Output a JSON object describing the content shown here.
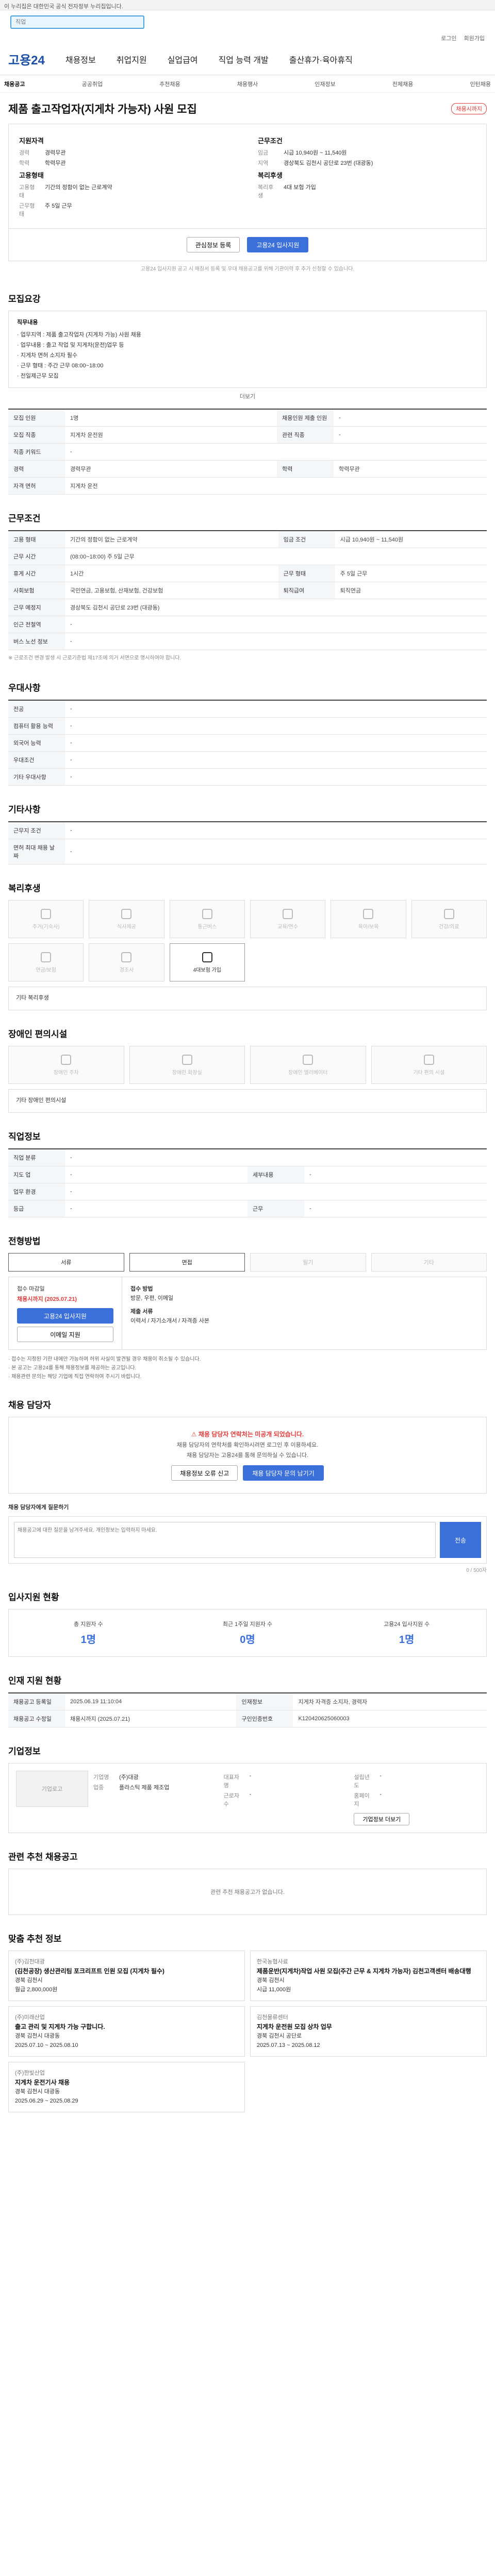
{
  "gov_bar": "이 누리집은 대한민국 공식 전자정부 누리집입니다.",
  "search": {
    "placeholder": "직업"
  },
  "util": [
    "로그인",
    "회원가입"
  ],
  "gnb": {
    "logo": "고용24",
    "items": [
      "채용정보",
      "취업지원",
      "실업급여",
      "직업 능력 개발",
      "출산휴가·육아휴직"
    ]
  },
  "subnav": [
    "채용공고",
    "공공취업",
    "추천채용",
    "채용행사",
    "인재정보",
    "전체채용",
    "인턴채용"
  ],
  "job": {
    "title": "제품 출고작업자(지게차 가능자) 사원 모집",
    "badge": "채용시까지"
  },
  "summary": {
    "left_h": "지원자격",
    "left": [
      [
        "경력",
        "경력무관"
      ],
      [
        "학력",
        "학력무관"
      ]
    ],
    "left2_h": "고용형태",
    "left2": [
      [
        "고용형태",
        "기간의 정함이 없는 근로계약"
      ],
      [
        "근무형태",
        "주 5일 근무"
      ]
    ],
    "right_h": "근무조건",
    "right": [
      [
        "임금",
        "시급 10,940원 ~ 11,540원"
      ],
      [
        "지역",
        "경상북도 김천시 공단로 23번 (대광동)"
      ]
    ],
    "right2_h": "복리후생",
    "right2": [
      [
        "복리후생",
        "4대 보험 가입"
      ]
    ]
  },
  "buttons": {
    "scrap": "관심정보 등록",
    "apply": "고용24 입사지원"
  },
  "apply_note": "고용24 입사지원 공고 시 매칭서 등록 및 우대 채용공고를 위해 기관이력 후 추가 신청할 수 있습니다.",
  "sec_job": "모집요강",
  "job_desc_title": "직무내용",
  "job_desc": [
    "· 업무지역 : 제품 출고작업자 (지게차 가능) 사원 채용",
    "· 업무내용 : 출고 작업 및 지게차(운전)업무 등",
    "· 지게차 면허 소지자 필수",
    "· 근무 형태 : 주간 근무 08:00~18:00",
    "· 전일제근무 모집"
  ],
  "expand": "더보기",
  "req_table": [
    [
      "모집 인원",
      "1명",
      "채용인원 제출 인원",
      "-"
    ],
    [
      "모집 직종",
      "지게차 운전원",
      "관련 직종",
      "-"
    ],
    [
      "직종 키워드",
      "-",
      "",
      ""
    ],
    [
      "경력",
      "경력무관",
      "학력",
      "학력무관"
    ],
    [
      "자격 면허",
      "지게차 운전",
      "",
      ""
    ]
  ],
  "sec_cond": "근무조건",
  "cond_table": [
    [
      "고용 형태",
      "기간의 정함이 없는 근로계약",
      "임금 조건",
      "시급 10,940원 ~ 11,540원"
    ],
    [
      "근무 시간",
      "(08:00~18:00) 주 5일 근무",
      "",
      ""
    ],
    [
      "휴게 시간",
      "1시간",
      "근무 형태",
      "주 5일 근무"
    ],
    [
      "사회보험",
      "국민연금, 고용보험, 산재보험, 건강보험",
      "퇴직급여",
      "퇴직연금"
    ],
    [
      "근무 예정지",
      "경상북도 김천시 공단로 23번 (대광동)",
      "",
      ""
    ],
    [
      "인근 전철역",
      "-",
      "",
      ""
    ],
    [
      "버스 노선 정보",
      "-",
      "",
      ""
    ]
  ],
  "cond_note": "※ 근로조건 변경 발생 시 근로기준법 제17조에 의거 서면으로 명시하여야 합니다.",
  "sec_pref": "우대사항",
  "pref_table": [
    [
      "전공",
      "-"
    ],
    [
      "컴퓨터 활용 능력",
      "-"
    ],
    [
      "외국어 능력",
      "-"
    ],
    [
      "우대조건",
      "-"
    ],
    [
      "기타 우대사항",
      "-"
    ]
  ],
  "sec_etc": "기타사항",
  "etc_table": [
    [
      "근무지 조건",
      "-"
    ],
    [
      "면허 최대 채용 날짜",
      "-"
    ]
  ],
  "sec_welfare": "복리후생",
  "welfare_icons": [
    "주거(기숙사)",
    "식사제공",
    "통근버스",
    "교육/연수",
    "육아/보육",
    "건강/의료",
    "연금/보험",
    "경조사",
    "4대보험 가입"
  ],
  "welfare_on": [
    8
  ],
  "etc_welfare": "기타 복리후생",
  "sec_disab": "장애인 편의시설",
  "disab_icons": [
    "장애인 주차",
    "장애인 화장실",
    "장애인 엘리베이터",
    "기타 편의 시설"
  ],
  "etc_disab": "기타 장애인 편의시설",
  "sec_jobinfo": "직업정보",
  "jobinfo_table": [
    [
      "직업 분류",
      "-",
      "",
      ""
    ],
    [
      "지도 업",
      "-",
      "세부내용",
      "-"
    ],
    [
      "업무 환경",
      "-",
      "",
      ""
    ],
    [
      "등급",
      "-",
      "근무",
      "-"
    ]
  ],
  "sec_method": "전형방법",
  "methods": [
    "서류",
    "면접",
    "필기",
    "기타"
  ],
  "methods_on": [
    0,
    1
  ],
  "apply_info": {
    "label": "접수 마감일",
    "deadline": "채용시까지 (2025.07.21)",
    "apply_btn": "고용24 입사지원",
    "email_btn": "이메일 지원",
    "r1": "접수 방법",
    "r1v": "방문, 우편, 이메일",
    "r2": "제출 서류",
    "r2v": "이력서 / 자기소개서 / 자격증 사본"
  },
  "apply_notes": [
    "· 접수는 지정된 기한 내에만 가능하며 허위 사실이 발견될 경우 채용이 취소될 수 있습니다.",
    "· 본 공고는 고용24를 통해 채용정보를 제공하는 공고입니다.",
    "· 채용관련 문의는 해당 기업에 직접 연락하여 주시기 바랍니다."
  ],
  "sec_contact": "채용 담당자",
  "contact_warn": "채용 담당자 연락처는 미공개 되었습니다.",
  "contact_desc": [
    "채용 담당자의 연락처를 확인하시려면 로그인 후 이용하세요.",
    "채용 담당자는 고용24를 통해 문의하실 수 있습니다."
  ],
  "contact_btns": [
    "채용정보 오류 신고",
    "채용 담당자 문의 남기기"
  ],
  "write": {
    "label": "채용 담당자에게 질문하기",
    "placeholder": "채용공고에 대한 질문을 남겨주세요. 개인정보는 입력하지 마세요.",
    "count": "0 / 500자",
    "btn": "전송"
  },
  "sec_stats": "입사지원 현황",
  "stats": [
    [
      "총 지원자 수",
      "1명"
    ],
    [
      "최근 1주일 지원자 수",
      "0명"
    ],
    [
      "고용24 입사지원 수",
      "1명"
    ]
  ],
  "sec_recruit": "인재 지원 현황",
  "recruit_table": [
    [
      "채용공고 등록일",
      "2025.06.19 11:10:04",
      "인재정보",
      "지게차 자격증 소지자, 경력자"
    ],
    [
      "채용공고 수정일",
      "채용시까지 (2025.07.21)",
      "구인인증번호",
      "K120420625060003"
    ]
  ],
  "sec_company": "기업정보",
  "company": {
    "logo": "기업로고",
    "rows": [
      [
        "기업명",
        "(주)대광"
      ],
      [
        "업종",
        "플라스틱 제품 제조업"
      ],
      [
        "대표자명",
        "-"
      ],
      [
        "근로자 수",
        "-"
      ],
      [
        "설립년도",
        "-"
      ],
      [
        "홈페이지",
        "-"
      ]
    ],
    "btn": "기업정보 더보기"
  },
  "sec_related": "관련 추천 채용공고",
  "related_empty": "관련 추천 채용공고가 없습니다.",
  "sec_rec": "맞춤 추천 정보",
  "recs": [
    {
      "co": "(주)김천대광",
      "title": "(김천공장) 생산관리팀 포크리프트 인원 모집 (지게차 필수)",
      "loc": "경북 김천시",
      "pay": "월급 2,800,000원"
    },
    {
      "co": "한국농협사료",
      "title": "제품운반(지게차)작업 사원 모집(주간 근무 & 지게차 가능자) 김천고객센터 배송대행",
      "loc": "경북 김천시",
      "pay": "시급 11,000원"
    },
    {
      "co": "(주)미래산업",
      "title": "출고 관리 및 지게차 가능 구합니다.",
      "loc": "경북 김천시 대광동",
      "pay": "2025.07.10 ~ 2025.08.10"
    },
    {
      "co": "김천물류센터",
      "title": "지게차 운전원 모집 상차 업무",
      "loc": "경북 김천시 공단로",
      "pay": "2025.07.13 ~ 2025.08.12"
    },
    {
      "co": "(주)한빛산업",
      "title": "지게차 운전기사 채용",
      "loc": "경북 김천시 대광동",
      "pay": "2025.06.29 ~ 2025.08.29"
    }
  ]
}
